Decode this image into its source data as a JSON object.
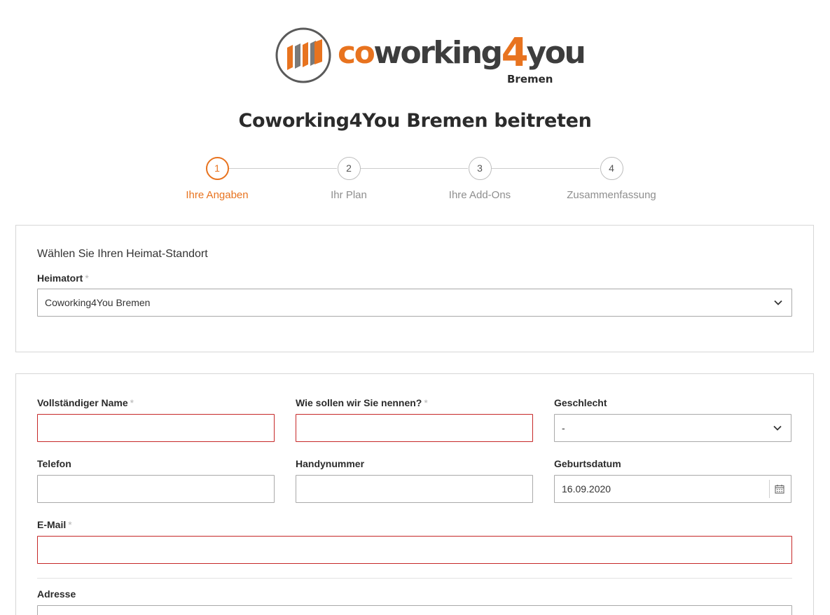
{
  "logo": {
    "text_co": "co",
    "text_working": "working",
    "text_four": "4",
    "text_you": "you",
    "subtitle": "Bremen",
    "icon": "logo-stripes-icon",
    "colors": {
      "orange": "#e8731f",
      "gray": "#3d3d3d"
    }
  },
  "page_title": "Coworking4You Bremen beitreten",
  "steps": [
    {
      "number": "1",
      "label": "Ihre Angaben",
      "active": true
    },
    {
      "number": "2",
      "label": "Ihr Plan",
      "active": false
    },
    {
      "number": "3",
      "label": "Ihre Add-Ons",
      "active": false
    },
    {
      "number": "4",
      "label": "Zusammenfassung",
      "active": false
    }
  ],
  "location_section": {
    "title": "Wählen Sie Ihren Heimat-Standort",
    "heimatort": {
      "label": "Heimatort",
      "required_mark": "*",
      "value": "Coworking4You Bremen"
    }
  },
  "details": {
    "full_name": {
      "label": "Vollständiger Name",
      "required_mark": "*",
      "value": ""
    },
    "nickname": {
      "label": "Wie sollen wir Sie nennen?",
      "required_mark": "*",
      "value": ""
    },
    "gender": {
      "label": "Geschlecht",
      "value": "-"
    },
    "phone": {
      "label": "Telefon",
      "value": ""
    },
    "mobile": {
      "label": "Handynummer",
      "value": ""
    },
    "birthdate": {
      "label": "Geburtsdatum",
      "value": "16.09.2020"
    },
    "email": {
      "label": "E-Mail",
      "required_mark": "*",
      "value": ""
    },
    "address": {
      "label": "Adresse",
      "value": ""
    }
  },
  "colors": {
    "accent": "#e8731f",
    "error_border": "#c62828",
    "border": "#a9a9a9"
  }
}
